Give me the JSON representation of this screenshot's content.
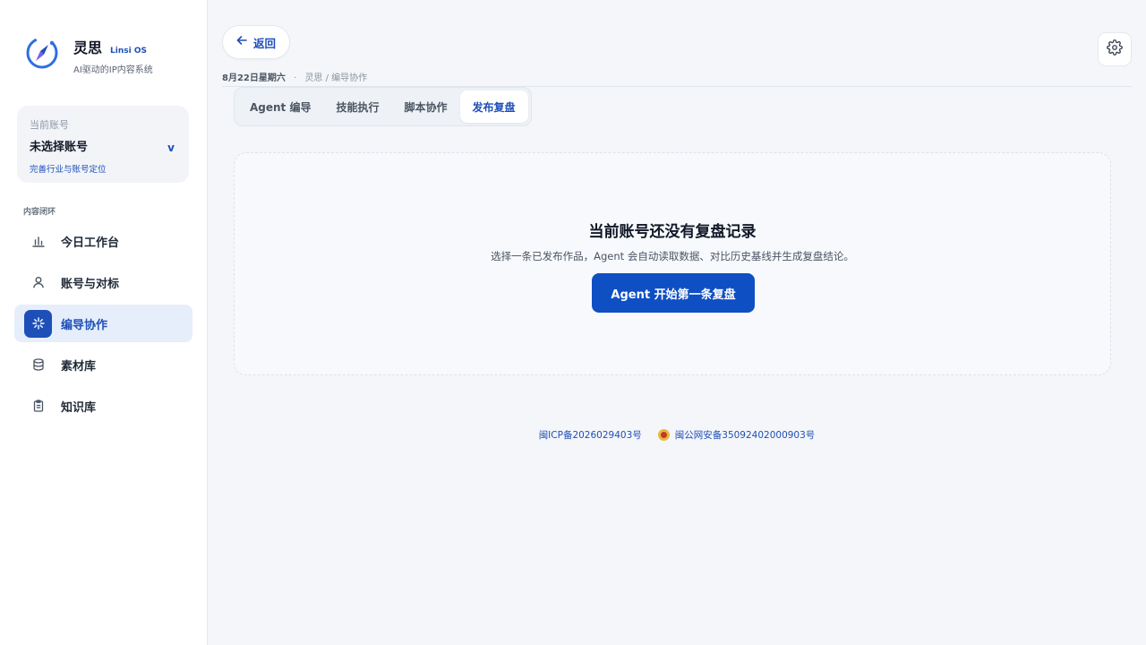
{
  "brand": {
    "name": "灵思",
    "sub": "Linsi OS",
    "tagline": "AI驱动的IP内容系统"
  },
  "account": {
    "label": "当前账号",
    "name": "未选择账号",
    "link": "完善行业与账号定位",
    "chevron": "v"
  },
  "sidebar": {
    "section_label": "内容闭环",
    "items": [
      {
        "label": "今日工作台",
        "icon": "bar-chart-icon"
      },
      {
        "label": "账号与对标",
        "icon": "user-icon"
      },
      {
        "label": "编导协作",
        "icon": "sparkle-icon",
        "active": true
      },
      {
        "label": "素材库",
        "icon": "database-icon"
      },
      {
        "label": "知识库",
        "icon": "clipboard-icon"
      }
    ]
  },
  "header": {
    "back_label": "返回",
    "date": "8月22日星期六",
    "breadcrumb": "灵思 / 编导协作",
    "settings_icon": "gear-icon"
  },
  "tabs": [
    {
      "label": "Agent 编导"
    },
    {
      "label": "技能执行"
    },
    {
      "label": "脚本协作"
    },
    {
      "label": "发布复盘",
      "active": true
    }
  ],
  "empty_state": {
    "title": "当前账号还没有复盘记录",
    "description": "选择一条已发布作品，Agent 会自动读取数据、对比历史基线并生成复盘结论。",
    "cta": "Agent 开始第一条复盘"
  },
  "footer": {
    "icp": "闽ICP备2026029403号",
    "police": "闽公网安备35092402000903号"
  },
  "colors": {
    "accent": "#1e4fb8",
    "cta": "#0f4fc4",
    "background": "#f4f6f9"
  }
}
